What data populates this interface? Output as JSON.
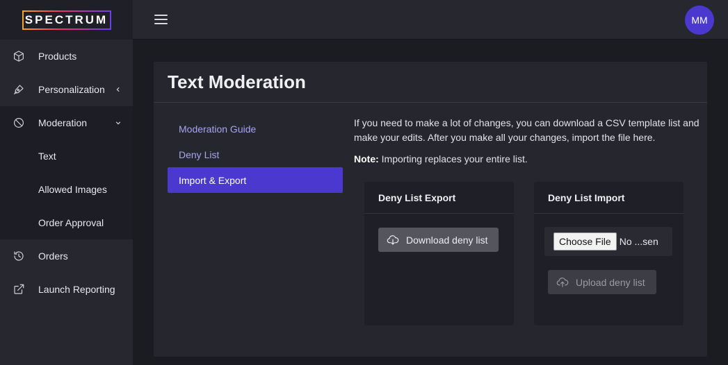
{
  "brand": {
    "logo_text": "SPECTRUM"
  },
  "sidebar": {
    "items": [
      {
        "label": "Products",
        "icon": "cube-icon"
      },
      {
        "label": "Personalization",
        "icon": "pen-nib-icon"
      },
      {
        "label": "Moderation",
        "icon": "ban-icon"
      },
      {
        "label": "Orders",
        "icon": "history-icon"
      },
      {
        "label": "Launch Reporting",
        "icon": "external-link-icon"
      }
    ],
    "moderation_sub": [
      "Text",
      "Allowed Images",
      "Order Approval"
    ]
  },
  "topbar": {
    "avatar_initials": "MM"
  },
  "page": {
    "title": "Text Moderation",
    "subnav": [
      "Moderation Guide",
      "Deny List",
      "Import & Export"
    ],
    "selected_subnav": "Import & Export",
    "description": "If you need to make a lot of changes, you can download a CSV template list and make your edits. After you make all your changes, import the file here.",
    "note_label": "Note:",
    "note_text": " Importing replaces your entire list.",
    "export_panel": {
      "title": "Deny List Export",
      "button_label": "Download deny list"
    },
    "import_panel": {
      "title": "Deny List Import",
      "choose_file_label": "Choose File",
      "file_status": "No ...sen",
      "upload_label": "Upload deny list"
    }
  },
  "colors": {
    "accent": "#4a38cf",
    "sidebar_bg": "#27272f",
    "page_bg": "#1b1b22",
    "card_bg": "#26262e"
  }
}
